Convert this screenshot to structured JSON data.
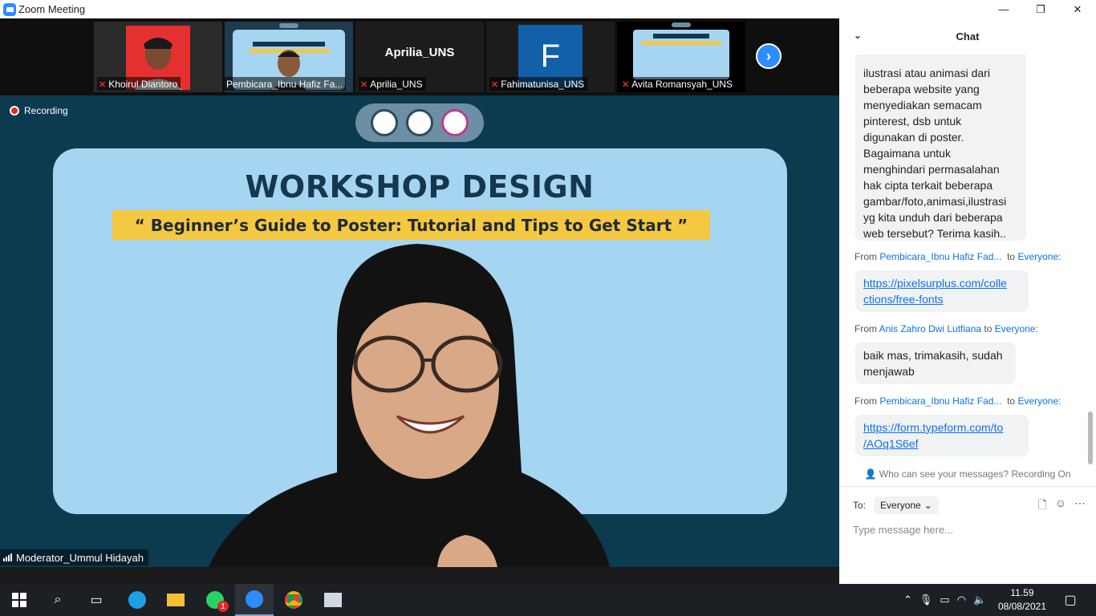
{
  "window": {
    "title": "Zoom Meeting",
    "minimize": "—",
    "restore": "❐",
    "close": "✕"
  },
  "gallery": {
    "participants": [
      {
        "name": "Khoirul Diantoro"
      },
      {
        "name": "Pembicara_Ibnu Hafiz Fa..."
      },
      {
        "name": "Aprilia_UNS",
        "tile_text": "Aprilia_UNS"
      },
      {
        "name": "Fahimatunisa_UNS",
        "tile_text": "F"
      },
      {
        "name": "Avita Romansyah_UNS"
      }
    ],
    "next": "›"
  },
  "main_video": {
    "recording_label": "Recording",
    "banner_title": "WORKSHOP DESIGN",
    "banner_subtitle": "“ Beginner’s Guide to Poster: Tutorial and Tips to Get Start ”",
    "speaker_name": "Moderator_Ummul Hidayah"
  },
  "chat": {
    "title": "Chat",
    "messages": [
      {
        "text_lines": [
          "ilustrasi atau animasi dari",
          "beberapa website yang",
          "menyediakan semacam",
          "pinterest, dsb untuk",
          "digunakan di poster.",
          "Bagaimana untuk",
          "menghindari permasalahan",
          "hak cipta terkait beberapa",
          "gambar/foto,animasi,ilustrasi",
          "yg kita unduh dari beberapa",
          "web tersebut? Terima kasih.."
        ]
      },
      {
        "from_label": "From",
        "from": "Pembicara_Ibnu Hafiz Fad...",
        "to_label": "to",
        "to": "Everyone:",
        "link_lines": [
          "https://pixelsurplus.com/colle",
          "ctions/free-fonts"
        ]
      },
      {
        "from_label": "From",
        "from": "Anis Zahro Dwi Lutfiana",
        "to_label": "to",
        "to": "Everyone:",
        "text_lines": [
          "baik mas, trimakasih, sudah",
          "menjawab"
        ]
      },
      {
        "from_label": "From",
        "from": "Pembicara_Ibnu Hafiz Fad...",
        "to_label": "to",
        "to": "Everyone:",
        "link_lines": [
          "https://form.typeform.com/to",
          "/AOq1S6ef"
        ]
      }
    ],
    "privacy_note": "Who can see your messages? Recording On",
    "to_label": "To:",
    "to_value": "Everyone",
    "input_placeholder": "Type message here..."
  },
  "taskbar": {
    "time": "11.59",
    "date": "08/08/2021",
    "whatsapp_badge": "1"
  },
  "colors": {
    "accent": "#2d8cff",
    "link": "#0e71eb",
    "muted": "#e02828",
    "banner_bg": "#a6d5f2",
    "subtitle_bg": "#f5c842"
  }
}
